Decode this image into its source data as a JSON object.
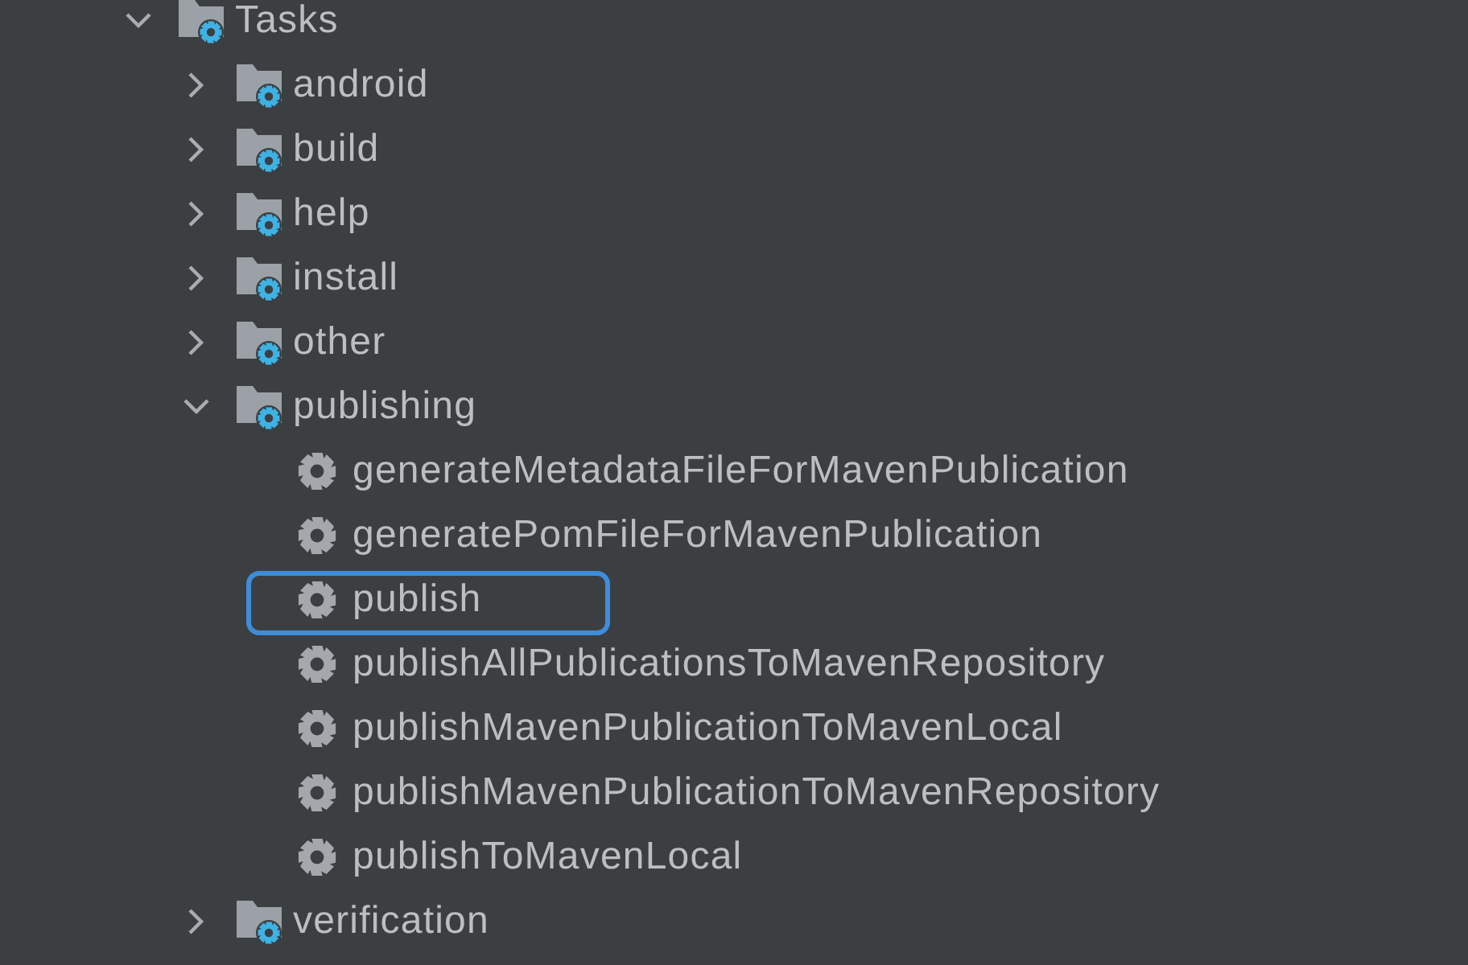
{
  "tree": [
    {
      "label": "Tasks",
      "kind": "folder",
      "expanded": true,
      "children": [
        {
          "label": "android",
          "kind": "folder",
          "expanded": false
        },
        {
          "label": "build",
          "kind": "folder",
          "expanded": false
        },
        {
          "label": "help",
          "kind": "folder",
          "expanded": false
        },
        {
          "label": "install",
          "kind": "folder",
          "expanded": false
        },
        {
          "label": "other",
          "kind": "folder",
          "expanded": false
        },
        {
          "label": "publishing",
          "kind": "folder",
          "expanded": true,
          "children": [
            {
              "label": "generateMetadataFileForMavenPublication",
              "kind": "task",
              "highlighted": false
            },
            {
              "label": "generatePomFileForMavenPublication",
              "kind": "task",
              "highlighted": false
            },
            {
              "label": "publish",
              "kind": "task",
              "highlighted": true
            },
            {
              "label": "publishAllPublicationsToMavenRepository",
              "kind": "task",
              "highlighted": false
            },
            {
              "label": "publishMavenPublicationToMavenLocal",
              "kind": "task",
              "highlighted": false
            },
            {
              "label": "publishMavenPublicationToMavenRepository",
              "kind": "task",
              "highlighted": false
            },
            {
              "label": "publishToMavenLocal",
              "kind": "task",
              "highlighted": false
            }
          ]
        },
        {
          "label": "verification",
          "kind": "folder",
          "expanded": false
        }
      ]
    }
  ]
}
